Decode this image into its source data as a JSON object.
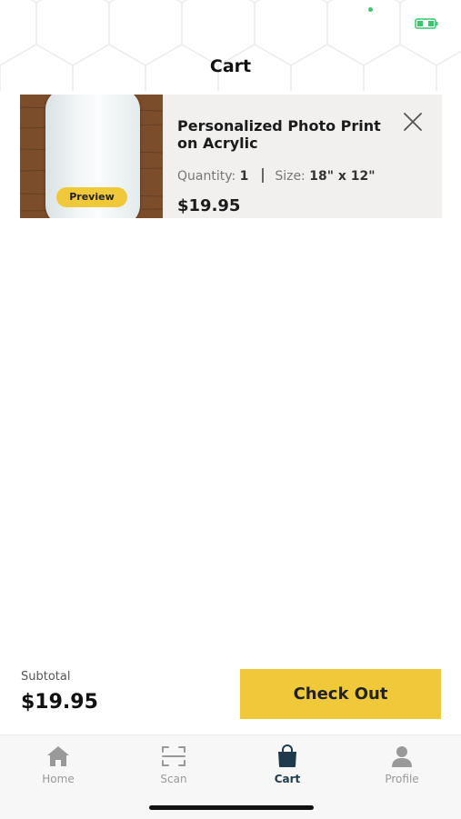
{
  "header": {
    "title": "Cart"
  },
  "cart": {
    "items": [
      {
        "name": "Personalized Photo Print on Acrylic",
        "preview_label": "Preview",
        "quantity_label": "Quantity:",
        "quantity_value": "1",
        "size_label": "Size:",
        "size_value": "18\" x 12\"",
        "price": "$19.95",
        "thumbnail_icon": "acrylic-print-photo"
      }
    ]
  },
  "summary": {
    "subtotal_label": "Subtotal",
    "subtotal_value": "$19.95",
    "checkout_label": "Check Out"
  },
  "tabbar": {
    "items": [
      {
        "label": "Home",
        "icon": "home-icon",
        "active": false
      },
      {
        "label": "Scan",
        "icon": "scan-icon",
        "active": false
      },
      {
        "label": "Cart",
        "icon": "shopping-bag-icon",
        "active": true
      },
      {
        "label": "Profile",
        "icon": "profile-icon",
        "active": false
      }
    ]
  },
  "colors": {
    "accent": "#f0c93a",
    "active_tab": "#1f3a4a",
    "inactive_tab": "#999999",
    "status_green": "#3cc66e"
  }
}
